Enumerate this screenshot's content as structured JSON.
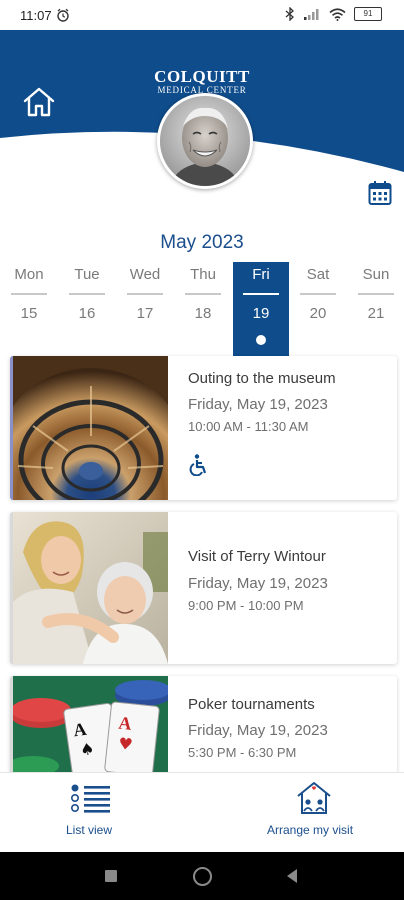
{
  "status_bar": {
    "time": "11:07",
    "battery": "91"
  },
  "header": {
    "brand_line1": "COLQUITT",
    "brand_line2": "MEDICAL CENTER",
    "brand_color": "#0f4c8b"
  },
  "calendar": {
    "month_title": "May 2023",
    "days": [
      {
        "name": "Mon",
        "num": "15",
        "selected": false
      },
      {
        "name": "Tue",
        "num": "16",
        "selected": false
      },
      {
        "name": "Wed",
        "num": "17",
        "selected": false
      },
      {
        "name": "Thu",
        "num": "18",
        "selected": false
      },
      {
        "name": "Fri",
        "num": "19",
        "selected": true
      },
      {
        "name": "Sat",
        "num": "20",
        "selected": false
      },
      {
        "name": "Sun",
        "num": "21",
        "selected": false
      }
    ]
  },
  "events": [
    {
      "title": "Outing to the museum",
      "date": "Friday, May 19, 2023",
      "time": "10:00 AM - 11:30 AM",
      "accessible": true,
      "image": "spiral-staircase-photo"
    },
    {
      "title": "Visit of Terry Wintour",
      "date": "Friday, May 19, 2023",
      "time": "9:00 PM - 10:00 PM",
      "accessible": false,
      "image": "caregiver-with-senior-photo"
    },
    {
      "title": "Poker tournaments",
      "date": "Friday, May 19, 2023",
      "time": "5:30 PM - 6:30 PM",
      "accessible": false,
      "image": "poker-cards-chips-photo"
    }
  ],
  "bottom_nav": {
    "list_view_label": "List view",
    "arrange_visit_label": "Arrange my visit"
  }
}
